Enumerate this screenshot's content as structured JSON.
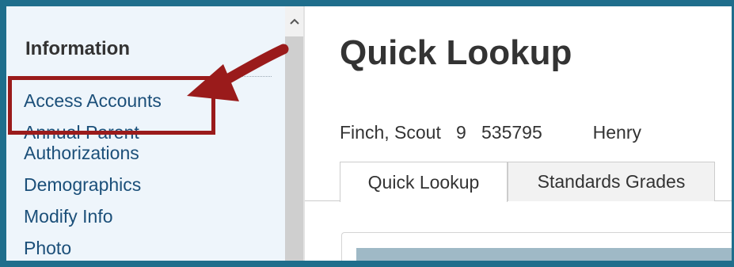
{
  "sidebar": {
    "heading": "Information",
    "items": [
      {
        "label": "Access Accounts"
      },
      {
        "label": "Annual Parent"
      },
      {
        "label": "Authorizations"
      },
      {
        "label": "Demographics"
      },
      {
        "label": "Modify Info"
      },
      {
        "label": "Photo"
      }
    ]
  },
  "scrollbar": {
    "up_glyph": "^"
  },
  "main": {
    "title": "Quick Lookup",
    "student": {
      "name": "Finch, Scout",
      "grade": "9",
      "id": "535795",
      "teacher": "Henry"
    },
    "tabs": [
      {
        "label": "Quick Lookup",
        "active": true
      },
      {
        "label": "Standards Grades",
        "active": false
      }
    ]
  },
  "annotation": {
    "color": "#9a1b1b"
  },
  "colors": {
    "frame": "#1f6e8c",
    "link": "#1b4f79",
    "sidebar_bg": "#eef5fb"
  }
}
